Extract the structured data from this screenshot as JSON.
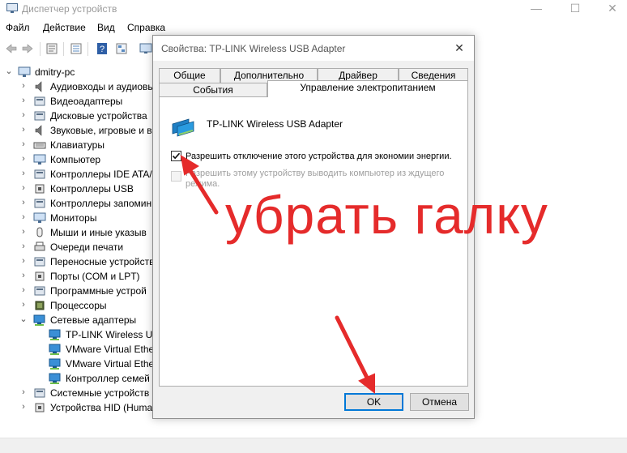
{
  "window": {
    "title": "Диспетчер устройств",
    "minimize_glyph": "—",
    "maximize_glyph": "☐",
    "close_glyph": "✕"
  },
  "menu": {
    "items": [
      "Файл",
      "Действие",
      "Вид",
      "Справка"
    ]
  },
  "toolbar": {
    "icons": [
      "back-icon",
      "forward-icon",
      "properties-icon",
      "list-icon",
      "help-icon",
      "details-icon",
      "monitor-icon"
    ]
  },
  "tree": {
    "root": "dmitry-pc",
    "items": [
      {
        "label": "Аудиовходы и аудиовы",
        "icon": "audio-icon"
      },
      {
        "label": "Видеоадаптеры",
        "icon": "display-adapter-icon"
      },
      {
        "label": "Дисковые устройства",
        "icon": "disk-icon"
      },
      {
        "label": "Звуковые, игровые и в",
        "icon": "sound-icon"
      },
      {
        "label": "Клавиатуры",
        "icon": "keyboard-icon"
      },
      {
        "label": "Компьютер",
        "icon": "computer-icon"
      },
      {
        "label": "Контроллеры IDE ATA/",
        "icon": "ide-icon"
      },
      {
        "label": "Контроллеры USB",
        "icon": "usb-icon"
      },
      {
        "label": "Контроллеры запомин",
        "icon": "storage-icon"
      },
      {
        "label": "Мониторы",
        "icon": "monitor-icon"
      },
      {
        "label": "Мыши и иные указыв",
        "icon": "mouse-icon"
      },
      {
        "label": "Очереди печати",
        "icon": "printer-icon"
      },
      {
        "label": "Переносные устройств",
        "icon": "portable-icon"
      },
      {
        "label": "Порты (COM и LPT)",
        "icon": "port-icon"
      },
      {
        "label": "Программные устрой",
        "icon": "software-icon"
      },
      {
        "label": "Процессоры",
        "icon": "cpu-icon"
      },
      {
        "label": "Сетевые адаптеры",
        "icon": "network-icon"
      }
    ],
    "network_children": [
      "TP-LINK Wireless USB",
      "VMware Virtual Ethe",
      "VMware Virtual Ethe",
      "Контроллер семей"
    ],
    "tail_items": [
      {
        "label": "Системные устройств",
        "icon": "system-icon"
      },
      {
        "label": "Устройства HID (Huma",
        "icon": "hid-icon"
      }
    ]
  },
  "dialog": {
    "title": "Свойства: TP-LINK Wireless USB Adapter",
    "close_glyph": "✕",
    "tabs_row1": [
      "Общие",
      "Дополнительно",
      "Драйвер",
      "Сведения"
    ],
    "tabs_row2": [
      "События",
      "Управление электропитанием"
    ],
    "active_tab": "Управление электропитанием",
    "device_name": "TP-LINK Wireless USB Adapter",
    "option_allow_off": {
      "label": "Разрешить отключение этого устройства для экономии энергии.",
      "checked": true
    },
    "option_wake": {
      "line1": "Разрешить этому устройству выводить компьютер из ждущего",
      "line2": "режима.",
      "checked": false
    },
    "ok_label": "OK",
    "cancel_label": "Отмена"
  },
  "annotation": {
    "text": "убрать галку",
    "color": "#e52b2b"
  }
}
